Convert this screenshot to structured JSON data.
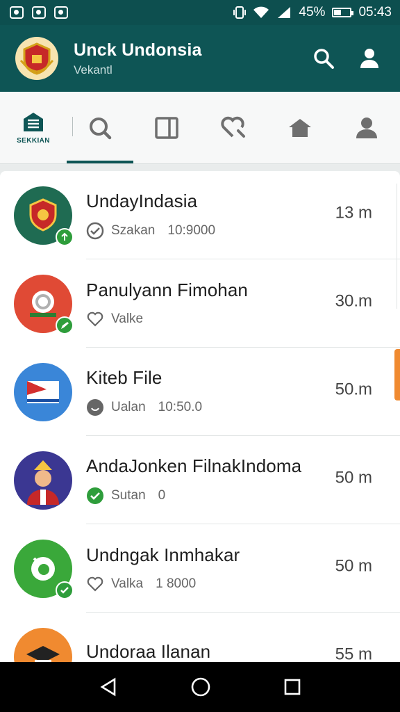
{
  "status_bar": {
    "battery": "45%",
    "time": "05:43",
    "battery_level": 0.45
  },
  "app_bar": {
    "title": "Unck Undonsia",
    "subtitle": "Vekantl"
  },
  "tabs": [
    {
      "label": "SEKKIAN",
      "icon": "building-icon",
      "active": true
    },
    {
      "label": "",
      "icon": "search-icon",
      "active": false
    },
    {
      "label": "",
      "icon": "document-icon",
      "active": false
    },
    {
      "label": "",
      "icon": "heart-search-icon",
      "active": false
    },
    {
      "label": "",
      "icon": "home-icon",
      "active": false
    },
    {
      "label": "",
      "icon": "person-icon",
      "active": false
    }
  ],
  "list": [
    {
      "name": "UndayIndasia",
      "meta_icon": "check-circle-icon",
      "meta": "Szakan",
      "meta2": "10:9000",
      "distance": "13 m",
      "avatar_bg": "#1f6b52"
    },
    {
      "name": "Panulyann Fimohan",
      "meta_icon": "heart-outline-icon",
      "meta": "Valke",
      "meta2": "",
      "distance": "30.m",
      "avatar_bg": "#e04a35"
    },
    {
      "name": "Kiteb File",
      "meta_icon": "smile-icon",
      "meta": "Ualan",
      "meta2": "10:50.0",
      "distance": "50.m",
      "avatar_bg": "#3a86d8"
    },
    {
      "name": "AndaJonken FilnakIndoma",
      "meta_icon": "check-circle-green-icon",
      "meta": "Sutan",
      "meta2": "0",
      "distance": "50 m",
      "avatar_bg": "#3b3792"
    },
    {
      "name": "Undngak Inmhakar",
      "meta_icon": "heart-outline-icon",
      "meta": "Valka",
      "meta2": "1 8000",
      "distance": "50 m",
      "avatar_bg": "#3aa83a"
    },
    {
      "name": "Undoraa Ilanan",
      "meta_icon": "",
      "meta": "",
      "meta2": "",
      "distance": "55 m",
      "avatar_bg": "#f08a30"
    }
  ]
}
